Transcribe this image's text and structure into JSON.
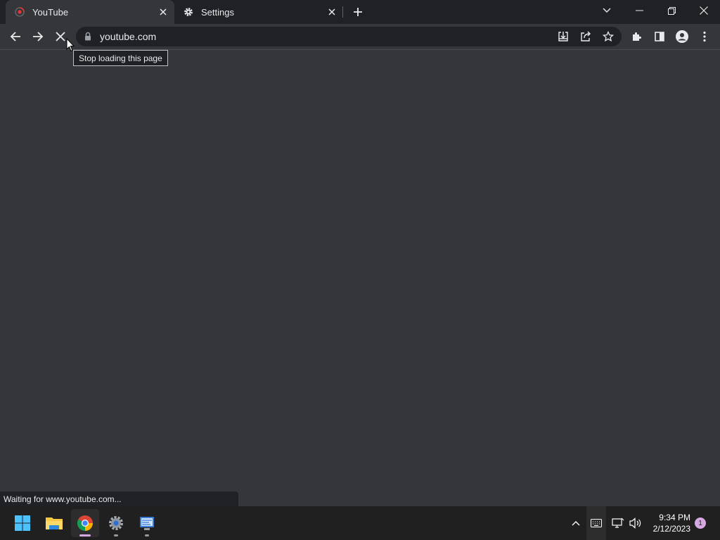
{
  "tabs": [
    {
      "title": "YouTube",
      "icon": "youtube-loading-icon",
      "active": true
    },
    {
      "title": "Settings",
      "icon": "gear-icon",
      "active": false
    }
  ],
  "toolbar": {
    "url": "youtube.com"
  },
  "tooltip": "Stop loading this page",
  "status": "Waiting for www.youtube.com...",
  "taskbar": {
    "time": "9:34 PM",
    "date": "2/12/2023",
    "notification_count": "1"
  },
  "colors": {
    "accent": "#d7a9e3",
    "page_bg": "#35363a",
    "tabstrip_bg": "#202124"
  }
}
